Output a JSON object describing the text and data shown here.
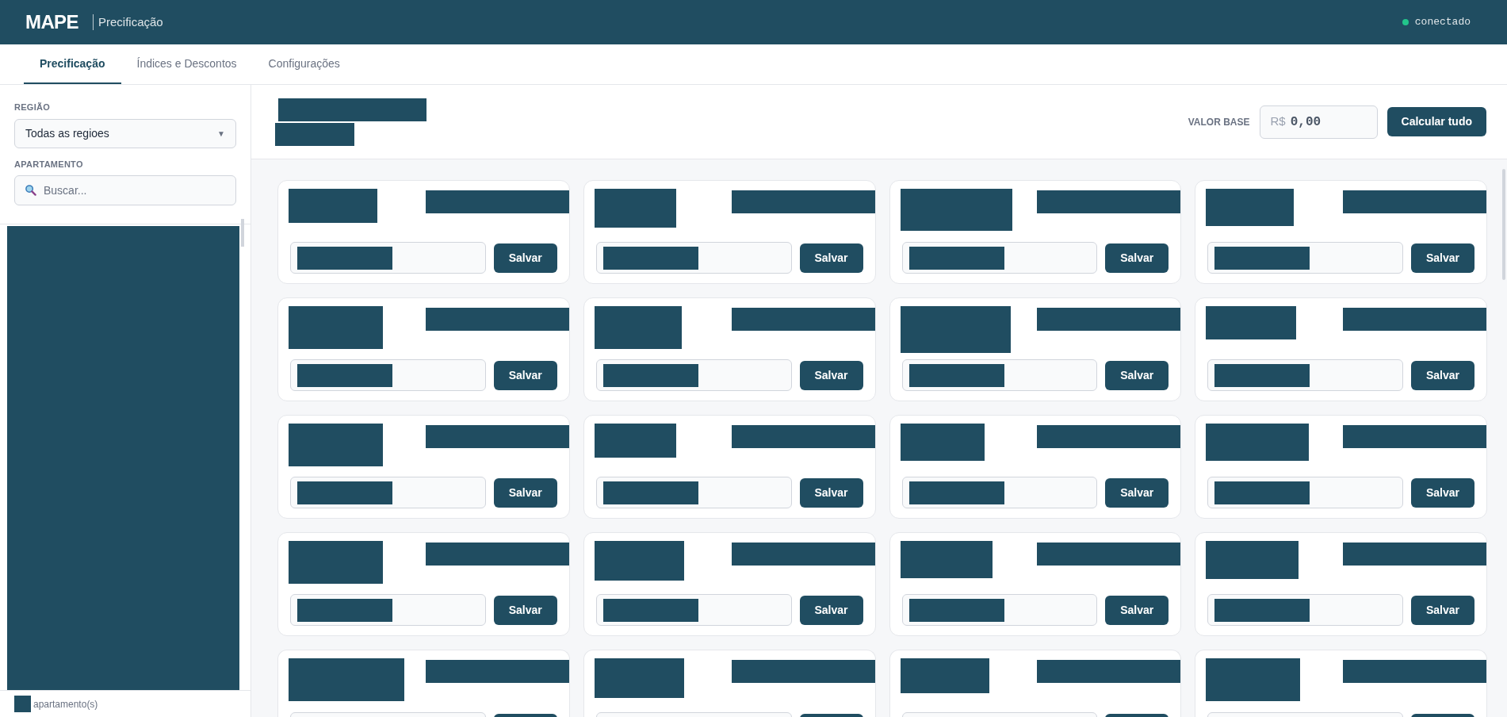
{
  "header": {
    "logo": "MAPE",
    "title": "Precificação",
    "status": {
      "label": "conectado",
      "color": "#22c58b"
    }
  },
  "tabs": [
    {
      "label": "Precificação",
      "selected": true
    },
    {
      "label": "Índices e Descontos",
      "selected": false
    },
    {
      "label": "Configurações",
      "selected": false
    }
  ],
  "sidebar": {
    "region_label": "REGIÃO",
    "region_value": "Todas as regioes",
    "region_caret": "▼",
    "apartment_label": "APARTAMENTO",
    "search_placeholder": "Buscar...",
    "footer": "apartamento(s)"
  },
  "toolbar": {
    "base_label": "VALOR BASE",
    "currency": "R$",
    "base_value": "0,00",
    "button": "Calcular tudo"
  },
  "cards": [
    {
      "kind": "full",
      "button": "Salvar"
    },
    {
      "kind": "full",
      "button": "Salvar"
    },
    {
      "kind": "full",
      "button": "Salvar"
    },
    {
      "kind": "full",
      "button": "Salvar"
    },
    {
      "kind": "full",
      "button": "Salvar"
    },
    {
      "kind": "full",
      "button": "Salvar"
    },
    {
      "kind": "full",
      "button": "Salvar"
    },
    {
      "kind": "full",
      "button": "Salvar"
    },
    {
      "kind": "full",
      "button": "Salvar"
    },
    {
      "kind": "full",
      "button": "Salvar"
    },
    {
      "kind": "full",
      "button": "Salvar"
    },
    {
      "kind": "full",
      "button": "Salvar"
    },
    {
      "kind": "full",
      "button": "Salvar"
    },
    {
      "kind": "full",
      "button": "Salvar"
    },
    {
      "kind": "full",
      "button": "Salvar"
    },
    {
      "kind": "full",
      "button": "Salvar"
    },
    {
      "kind": "partial"
    },
    {
      "kind": "partial"
    },
    {
      "kind": "partial"
    },
    {
      "kind": "partial"
    }
  ]
}
